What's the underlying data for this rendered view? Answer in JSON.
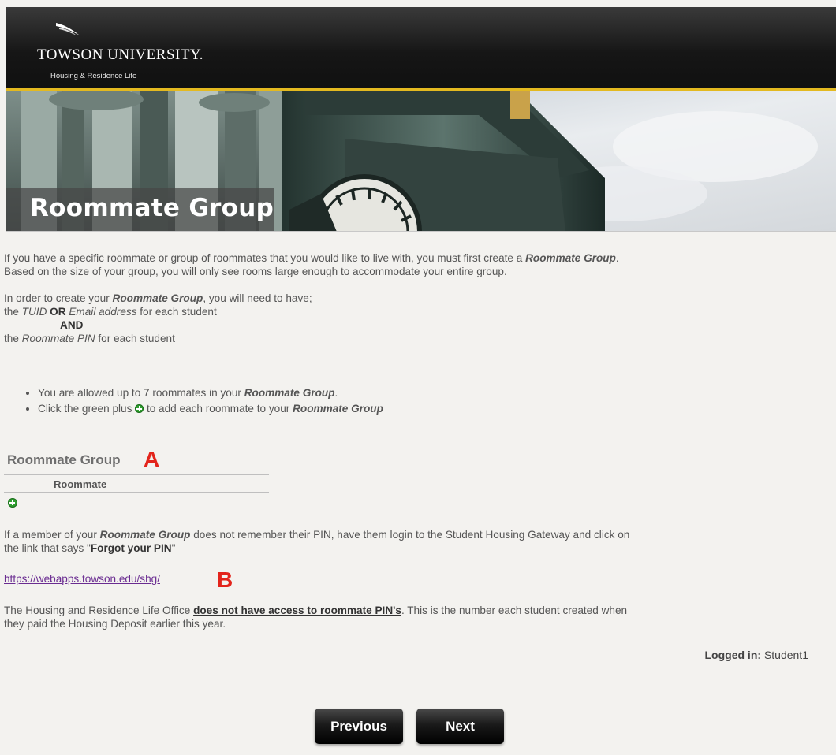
{
  "header": {
    "university": "TOWSON UNIVERSITY.",
    "department": "Housing & Residence Life"
  },
  "banner": {
    "title": "Roommate Group"
  },
  "intro": {
    "p1_line1_a": "If you have a specific roommate or group of roommates that you would like to live with, you must first create a ",
    "p1_line1_b": "Roommate Group",
    "p1_line1_c": ".",
    "p1_line2": "Based on the size of your group, you will only see rooms large enough to accommodate your entire group.",
    "p2_line1_a": "In order to create your ",
    "p2_line1_b": "Roommate Group",
    "p2_line1_c": ", you will need to have;",
    "p2_line2_a": "the ",
    "p2_line2_b": "TUID",
    "p2_line2_c": " OR ",
    "p2_line2_d": "Email address",
    "p2_line2_e": " for each student",
    "p2_line3": "AND",
    "p2_line4_a": "the ",
    "p2_line4_b": "Roommate PIN",
    "p2_line4_c": " for each student"
  },
  "bullets": {
    "b1_a": "You are allowed up to 7 roommates in your ",
    "b1_b": "Roommate Group",
    "b1_c": ".",
    "b2_a": "Click the green plus ",
    "b2_b": " to add each roommate to your ",
    "b2_c": "Roommate Group"
  },
  "roommate_group": {
    "heading": "Roommate Group",
    "marker": "A",
    "column_header": "Roommate"
  },
  "forgot": {
    "line1_a": "If a member of your ",
    "line1_b": "Roommate Group",
    "line1_c": " does not remember their PIN, have them login to the Student Housing Gateway and click on",
    "line2_a": "the link that says \"",
    "line2_b": "Forgot your PIN",
    "line2_c": "\""
  },
  "link": {
    "url": "https://webapps.towson.edu/shg/",
    "marker": "B"
  },
  "notice": {
    "line1_a": "The Housing and Residence Life Office ",
    "line1_b": "does not have access to roommate PIN's",
    "line1_c": ".  This is the number each student created when",
    "line2": "they paid the Housing Deposit earlier this year."
  },
  "status": {
    "logged_label": "Logged in:",
    "user": "Student1"
  },
  "nav": {
    "previous": "Previous",
    "next": "Next"
  },
  "colors": {
    "gold": "#e3b920",
    "marker_red": "#e3241b",
    "add_green": "#2f9e2f",
    "link_purple": "#6a2c91"
  }
}
